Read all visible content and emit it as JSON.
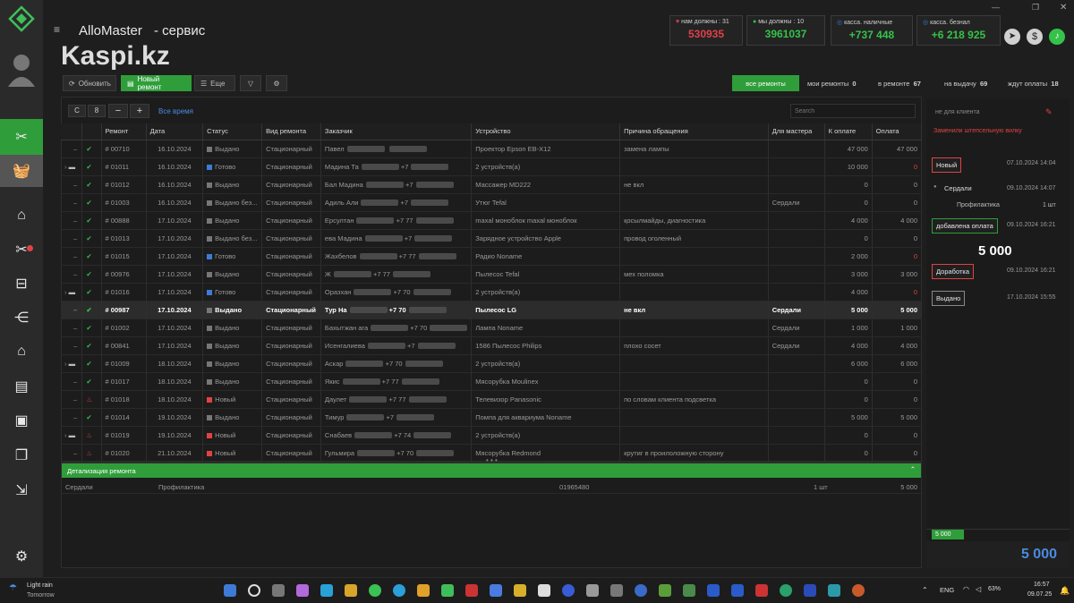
{
  "app": {
    "title": "AlloMaster",
    "subtitle": "- сервис",
    "watermark": "Kaspi.kz"
  },
  "stats": [
    {
      "label": "нам должны :",
      "count": "31",
      "value": "530935",
      "color": "#e0404a"
    },
    {
      "label": "мы должны :",
      "count": "10",
      "value": "3961037",
      "color": "#35c24a"
    },
    {
      "label": "касса. наличные",
      "count": "",
      "value": "+737 448",
      "color": "#35c24a"
    },
    {
      "label": "касса. безнал",
      "count": "",
      "value": "+6 218 925",
      "color": "#35c24a"
    }
  ],
  "toolbar": {
    "refresh": "Обновить",
    "new_repair": "Новый ремонт",
    "more": "Еще"
  },
  "tabs": [
    {
      "label": "все ремонты",
      "count": ""
    },
    {
      "label": "мои ремонты",
      "count": "0"
    },
    {
      "label": "в ремонте",
      "count": "67"
    },
    {
      "label": "на выдачу",
      "count": "69"
    },
    {
      "label": "ждут оплаты",
      "count": "18"
    }
  ],
  "filter": {
    "from": "С",
    "to": "8",
    "all_time": "Все время",
    "search_placeholder": "Search"
  },
  "columns": [
    "Ремонт",
    "Дата",
    "Статус",
    "Вид ремонта",
    "Заказчик",
    "Устройство",
    "Причина обращения",
    "Для мастера",
    "К оплате",
    "Оплата"
  ],
  "rows": [
    {
      "id": "# 00710",
      "date": "16.10.2024",
      "status": "Выдано",
      "sc": "#777777",
      "type": "Стационарный",
      "client": "Павел",
      "phone": "",
      "device": "Проектор Epson EB-X12",
      "reason": "замена лампы",
      "master": "",
      "due": "47 000",
      "paid": "47 000",
      "icon": "check",
      "folder": false,
      "partial": true
    },
    {
      "id": "# 01011",
      "date": "16.10.2024",
      "status": "Готово",
      "sc": "#3d7bd6",
      "type": "Стационарный",
      "client": "Мадина Та",
      "phone": "+7",
      "device": "2 устройств(а)",
      "reason": "",
      "master": "",
      "due": "10 000",
      "paid": "0",
      "icon": "check",
      "folder": true,
      "paidRed": true
    },
    {
      "id": "# 01012",
      "date": "16.10.2024",
      "status": "Выдано",
      "sc": "#777777",
      "type": "Стационарный",
      "client": "Бал Мадина",
      "phone": "+7",
      "device": "Массажер MD222",
      "reason": "не вкл",
      "master": "",
      "due": "0",
      "paid": "0",
      "icon": "check",
      "folder": false
    },
    {
      "id": "# 01003",
      "date": "16.10.2024",
      "status": "Выдано без...",
      "sc": "#777777",
      "type": "Стационарный",
      "client": "Адиль Али",
      "phone": "+7",
      "device": "Утюг Tefal",
      "reason": "",
      "master": "Сердали",
      "due": "0",
      "paid": "0",
      "icon": "check",
      "folder": false
    },
    {
      "id": "# 00888",
      "date": "17.10.2024",
      "status": "Выдано",
      "sc": "#777777",
      "type": "Стационарный",
      "client": "Ерсултан",
      "phone": "+7 77",
      "device": "maxal моноблок maxal моноблок",
      "reason": "қосылмайды, диагностика",
      "master": "",
      "due": "4 000",
      "paid": "4 000",
      "icon": "check",
      "folder": false
    },
    {
      "id": "# 01013",
      "date": "17.10.2024",
      "status": "Выдано без...",
      "sc": "#777777",
      "type": "Стационарный",
      "client": "ева Мадина",
      "phone": "+7",
      "device": "Зарядное устройство Apple",
      "reason": "провод оголенный",
      "master": "",
      "due": "0",
      "paid": "0",
      "icon": "check",
      "folder": false
    },
    {
      "id": "# 01015",
      "date": "17.10.2024",
      "status": "Готово",
      "sc": "#3d7bd6",
      "type": "Стационарный",
      "client": "Жахбелов",
      "phone": "+7 77",
      "device": "Радио Noname",
      "reason": "",
      "master": "",
      "due": "2 000",
      "paid": "0",
      "icon": "check",
      "folder": false,
      "paidRed": true
    },
    {
      "id": "# 00976",
      "date": "17.10.2024",
      "status": "Выдано",
      "sc": "#777777",
      "type": "Стационарный",
      "client": "Ж",
      "phone": "+7 77",
      "device": "Пылесос Tefal",
      "reason": "мех поломка",
      "master": "",
      "due": "3 000",
      "paid": "3 000",
      "icon": "check",
      "folder": false
    },
    {
      "id": "# 01016",
      "date": "17.10.2024",
      "status": "Готово",
      "sc": "#3d7bd6",
      "type": "Стационарный",
      "client": "Оразхан",
      "phone": "+7 70",
      "device": "2 устройств(а)",
      "reason": "",
      "master": "",
      "due": "4 000",
      "paid": "0",
      "icon": "check",
      "folder": true,
      "paidRed": true
    },
    {
      "id": "# 00987",
      "date": "17.10.2024",
      "status": "Выдано",
      "sc": "#777777",
      "type": "Стационарный",
      "client": "Тур На",
      "phone": "+7 70",
      "device": "Пылесос LG",
      "reason": "не вкл",
      "master": "Сердали",
      "due": "5 000",
      "paid": "5 000",
      "icon": "check",
      "folder": false,
      "selected": true
    },
    {
      "id": "# 01002",
      "date": "17.10.2024",
      "status": "Выдано",
      "sc": "#777777",
      "type": "Стационарный",
      "client": "Бахытжан ага",
      "phone": "+7 70",
      "device": "Лампа Noname",
      "reason": "",
      "master": "Сердали",
      "due": "1 000",
      "paid": "1 000",
      "icon": "check",
      "folder": false
    },
    {
      "id": "# 00841",
      "date": "17.10.2024",
      "status": "Выдано",
      "sc": "#777777",
      "type": "Стационарный",
      "client": "Исенгалиева",
      "phone": "+7",
      "device": "1586 Пылесос Philips",
      "reason": "плохо сосет",
      "master": "Сердали",
      "due": "4 000",
      "paid": "4 000",
      "icon": "check",
      "folder": false
    },
    {
      "id": "# 01009",
      "date": "18.10.2024",
      "status": "Выдано",
      "sc": "#777777",
      "type": "Стационарный",
      "client": "Аскар",
      "phone": "+7 70",
      "device": "2 устройств(а)",
      "reason": "",
      "master": "",
      "due": "6 000",
      "paid": "6 000",
      "icon": "check",
      "folder": true
    },
    {
      "id": "# 01017",
      "date": "18.10.2024",
      "status": "Выдано",
      "sc": "#777777",
      "type": "Стационарный",
      "client": "Якис",
      "phone": "+7 77",
      "device": "Мясорубка Moulinex",
      "reason": "",
      "master": "",
      "due": "0",
      "paid": "0",
      "icon": "check",
      "folder": false
    },
    {
      "id": "# 01018",
      "date": "18.10.2024",
      "status": "Новый",
      "sc": "#e04343",
      "type": "Стационарный",
      "client": "Даулет",
      "phone": "+7 77",
      "device": "Телевизор Panasonic",
      "reason": "по словам клиента подсветка",
      "master": "",
      "due": "0",
      "paid": "0",
      "icon": "fire",
      "folder": false
    },
    {
      "id": "# 01014",
      "date": "19.10.2024",
      "status": "Выдано",
      "sc": "#777777",
      "type": "Стационарный",
      "client": "Тимур",
      "phone": "+7",
      "device": "Помпа для аквариума Noname",
      "reason": "",
      "master": "",
      "due": "5 000",
      "paid": "5 000",
      "icon": "check",
      "folder": false
    },
    {
      "id": "# 01019",
      "date": "19.10.2024",
      "status": "Новый",
      "sc": "#e04343",
      "type": "Стационарный",
      "client": "Снабаев",
      "phone": "+7 74",
      "device": "2 устройств(а)",
      "reason": "",
      "master": "",
      "due": "0",
      "paid": "0",
      "icon": "fire",
      "folder": true
    },
    {
      "id": "# 01020",
      "date": "21.10.2024",
      "status": "Новый",
      "sc": "#e04343",
      "type": "Стационарный",
      "client": "Гульмира",
      "phone": "+7 70",
      "device": "Мясорубка Redmond",
      "reason": "крутиг в проилоложную сторону",
      "master": "",
      "due": "0",
      "paid": "0",
      "icon": "fire",
      "folder": false
    }
  ],
  "detail": {
    "title": "Детализация ремонта",
    "master": "Сердали",
    "work": "Профилактика",
    "code": "01965480",
    "qty": "1 шт",
    "sum": "5 000"
  },
  "right": {
    "client_note_placeholder": "не для клиента",
    "client_note": "Заменили штепсельную вилку",
    "history": [
      {
        "badge": "Новый",
        "time": "07.10.2024  14:04"
      },
      {
        "badge": "Сердали",
        "time": "09.10.2024  14:07"
      },
      {
        "badge": "Профилактика",
        "time": "1 шт"
      },
      {
        "badge": "добавлена оплата",
        "time": "09.10.2024  16:21"
      },
      {
        "badge": "5 000",
        "time": ""
      },
      {
        "badge": "Доработка",
        "time": "09.10.2024  16:21"
      },
      {
        "badge": "Выдано",
        "time": "17.10.2024  15:55"
      }
    ],
    "total_small": "5 000",
    "total_big": "5 000"
  },
  "taskbar": {
    "weather": "Light rain",
    "weather_sub": "Tomorrow",
    "lang": "ENG",
    "battery": "63%",
    "time": "16:57",
    "date": "09.07.25"
  },
  "colors": {
    "accent": "#2f9e3a",
    "bg": "#1e1e1e",
    "red": "#e04343"
  }
}
